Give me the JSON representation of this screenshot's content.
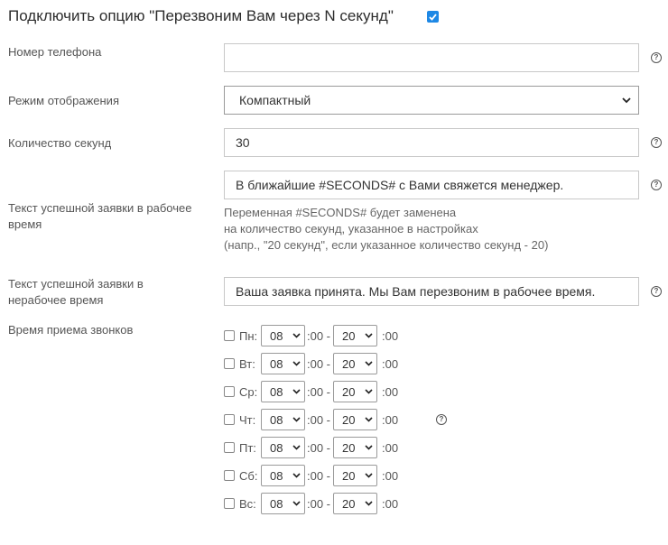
{
  "title": "Подключить опцию \"Перезвоним Вам через N секунд\"",
  "title_checked": true,
  "fields": {
    "phone": {
      "label": "Номер телефона",
      "value": ""
    },
    "display_mode": {
      "label": "Режим отображения",
      "value": "Компактный"
    },
    "seconds": {
      "label": "Количество секунд",
      "value": "30"
    },
    "success_work": {
      "label": "Текст успешной заявки в рабочее время",
      "value": "В ближайшие #SECONDS# с Вами свяжется менеджер.",
      "hint": [
        "Переменная #SECONDS# будет заменена",
        "на количество секунд, указанное в настройках",
        "(напр., \"20 секунд\", если указанное количество секунд - 20)"
      ]
    },
    "success_offhours": {
      "label": "Текст успешной заявки в нерабочее время",
      "value": "Ваша заявка принята. Мы Вам перезвоним в рабочее время."
    }
  },
  "schedule": {
    "label": "Время приема звонков",
    "sep": ":00 -",
    "suffix": ":00",
    "days": [
      {
        "label": "Пн:",
        "checked": false,
        "from": "08",
        "to": "20"
      },
      {
        "label": "Вт:",
        "checked": false,
        "from": "08",
        "to": "20"
      },
      {
        "label": "Ср:",
        "checked": false,
        "from": "08",
        "to": "20"
      },
      {
        "label": "Чт:",
        "checked": false,
        "from": "08",
        "to": "20"
      },
      {
        "label": "Пт:",
        "checked": false,
        "from": "08",
        "to": "20"
      },
      {
        "label": "Сб:",
        "checked": false,
        "from": "08",
        "to": "20"
      },
      {
        "label": "Вс:",
        "checked": false,
        "from": "08",
        "to": "20"
      }
    ]
  },
  "help_glyph": "?",
  "colors": {
    "accent": "#1e88e5",
    "border": "#c8c8c8"
  }
}
